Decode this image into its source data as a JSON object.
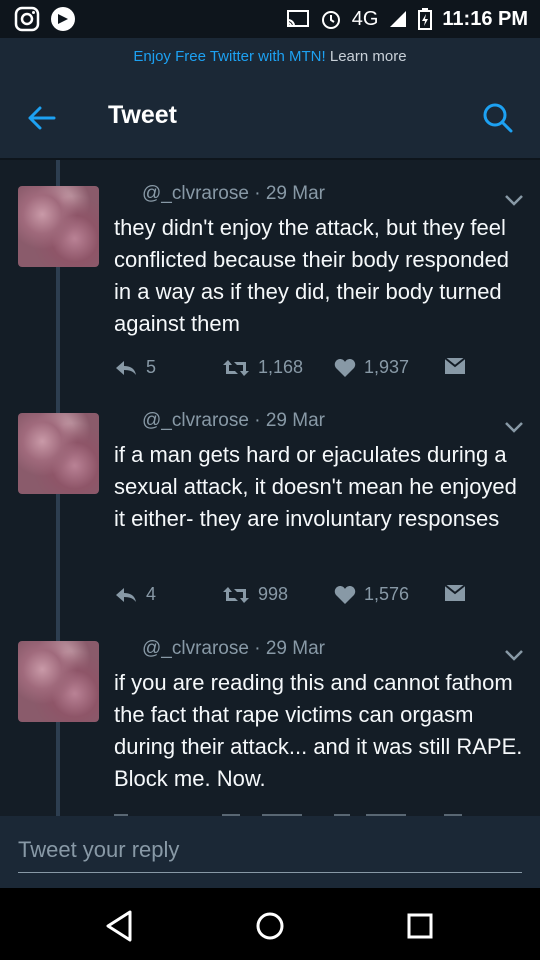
{
  "status_bar": {
    "network": "4G",
    "network_super": "4G",
    "time": "11:16 PM"
  },
  "promo": {
    "text": "Enjoy Free Twitter with MTN!",
    "link": "Learn more"
  },
  "app_bar": {
    "title": "Tweet"
  },
  "tweets": [
    {
      "handle": "@_clvrarose",
      "date": "29 Mar",
      "text": "they didn't enjoy the attack, but they feel conflicted because their body responded in a way as if they did, their body turned against them",
      "replies": "5",
      "retweets": "1,168",
      "likes": "1,937"
    },
    {
      "handle": "@_clvrarose",
      "date": "29 Mar",
      "text": "if a man gets hard or ejaculates during a sexual attack, it doesn't mean he enjoyed it either- they are involuntary responses",
      "replies": "4",
      "retweets": "998",
      "likes": "1,576"
    },
    {
      "handle": "@_clvrarose",
      "date": "29 Mar",
      "text": "if you are reading this and cannot fathom the fact that rape victims can orgasm during their attack... and it was still RAPE. Block me. Now."
    }
  ],
  "reply": {
    "placeholder": "Tweet your reply"
  },
  "colors": {
    "background": "#141d26",
    "bar": "#1b2836",
    "accent": "#1da1f2",
    "muted": "#8899a6"
  }
}
